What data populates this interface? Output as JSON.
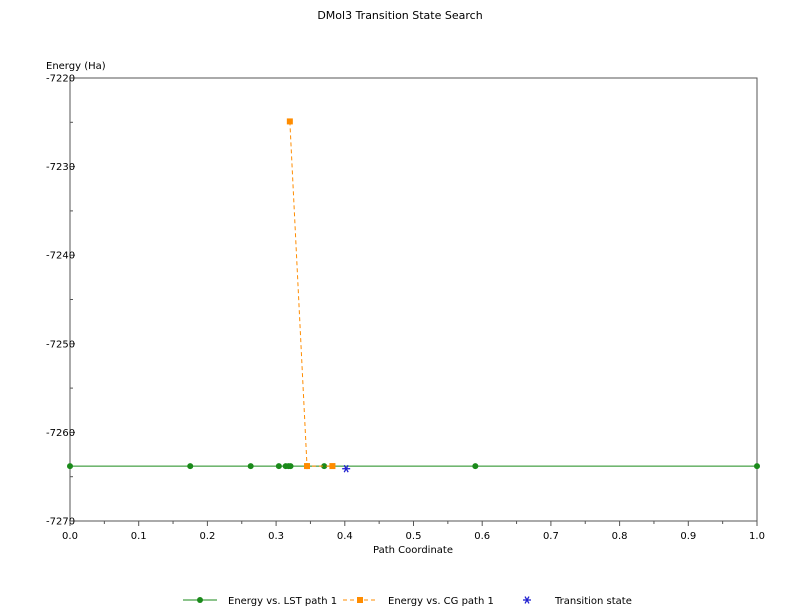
{
  "chart_data": {
    "type": "line",
    "title": "DMol3 Transition State Search",
    "xlabel": "Path Coordinate",
    "ylabel": "Energy (Ha)",
    "xlim": [
      0,
      1
    ],
    "ylim": [
      -7270,
      -7220
    ],
    "xticks": [
      0.0,
      0.1,
      0.2,
      0.3,
      0.4,
      0.5,
      0.6,
      0.7,
      0.8,
      0.9,
      1.0
    ],
    "xtick_labels": [
      "0.0",
      "0.1",
      "0.2",
      "0.3",
      "0.4",
      "0.5",
      "0.6",
      "0.7",
      "0.8",
      "0.9",
      "1.0"
    ],
    "yticks": [
      -7270,
      -7260,
      -7250,
      -7240,
      -7230,
      -7220
    ],
    "ytick_labels": [
      "-7270",
      "-7260",
      "-7250",
      "-7240",
      "-7230",
      "-7220"
    ],
    "grid": false,
    "legend_position": "bottom",
    "series": [
      {
        "name": "Energy vs. LST path 1",
        "style": "solid",
        "marker": "circle",
        "color": "#1a8a1a",
        "x": [
          0.0,
          0.175,
          0.263,
          0.304,
          0.314,
          0.318,
          0.321,
          0.345,
          0.37,
          0.59,
          1.0
        ],
        "y": [
          -7263.8,
          -7263.8,
          -7263.8,
          -7263.8,
          -7263.8,
          -7263.8,
          -7263.8,
          -7263.8,
          -7263.8,
          -7263.8,
          -7263.8
        ]
      },
      {
        "name": "Energy vs. CG path 1",
        "style": "dashed",
        "marker": "square",
        "color": "#ff8c00",
        "x": [
          0.32,
          0.345,
          0.382
        ],
        "y": [
          -7224.9,
          -7263.8,
          -7263.8
        ]
      },
      {
        "name": "Transition state",
        "style": "none",
        "marker": "star",
        "color": "#2020d0",
        "x": [
          0.402
        ],
        "y": [
          -7264.1
        ]
      }
    ]
  }
}
